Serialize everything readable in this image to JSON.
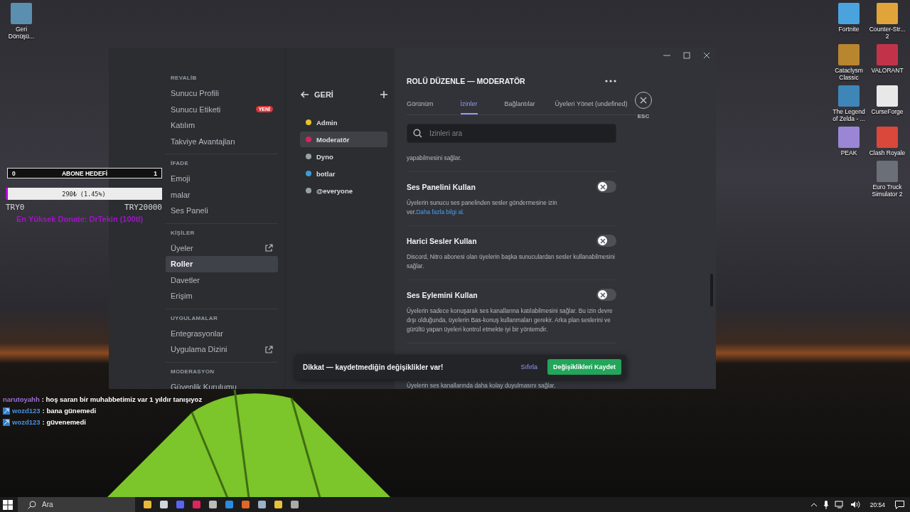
{
  "desktop_icons_left": [
    {
      "label": "Geri Dönüşü...",
      "color": "#5b8fb0"
    }
  ],
  "desktop_icons": [
    {
      "label": "Fortnite",
      "color": "#4aa3df"
    },
    {
      "label": "Counter-Str... 2",
      "color": "#e0a43a"
    },
    {
      "label": "Cataclysm Classic",
      "color": "#b8862f"
    },
    {
      "label": "VALORANT",
      "color": "#c2334a"
    },
    {
      "label": "The Legend of Zelda - ...",
      "color": "#3f86b8"
    },
    {
      "label": "CurseForge",
      "color": "#e8e8e8"
    },
    {
      "label": "PEAK",
      "color": "#9b86d6"
    },
    {
      "label": "Clash Royale",
      "color": "#d9483b"
    },
    {
      "label": "Euro Truck Simulator 2",
      "color": "#6a6f78"
    }
  ],
  "overlay": {
    "goal": {
      "start": "0",
      "title": "ABONE HEDEFİ",
      "end": "1"
    },
    "donation": {
      "reading": "290₺ (1.45%)",
      "level": 0.0145,
      "min": "TRY0",
      "max": "TRY20000",
      "top_donor": "En Yüksek Donate: DrTekin (100tl)"
    }
  },
  "window": {
    "sidebar": {
      "sections": [
        {
          "title": "REVALİB",
          "items": [
            {
              "label": "Sunucu Profili",
              "selected": false,
              "external": false
            },
            {
              "label": "Sunucu Etiketi",
              "selected": false,
              "external": false,
              "badge": "YENİ"
            },
            {
              "label": "Katılım",
              "selected": false,
              "external": false
            },
            {
              "label": "Takviye Avantajları",
              "selected": false,
              "external": false
            }
          ]
        },
        {
          "title": "İFADE",
          "items": [
            {
              "label": "Emoji",
              "selected": false,
              "external": false
            },
            {
              "label": "malar",
              "selected": false,
              "external": false
            },
            {
              "label": "Ses Paneli",
              "selected": false,
              "external": false
            }
          ]
        },
        {
          "title": "KİŞİLER",
          "items": [
            {
              "label": "Üyeler",
              "selected": false,
              "external": true
            },
            {
              "label": "Roller",
              "selected": true,
              "external": false
            },
            {
              "label": "Davetler",
              "selected": false,
              "external": false
            },
            {
              "label": "Erişim",
              "selected": false,
              "external": false
            }
          ]
        },
        {
          "title": "UYGULAMALAR",
          "items": [
            {
              "label": "Entegrasyonlar",
              "selected": false,
              "external": false
            },
            {
              "label": "Uygulama Dizini",
              "selected": false,
              "external": true
            }
          ]
        },
        {
          "title": "MODERASYON",
          "items": [
            {
              "label": "Güvenlik Kurulumu",
              "selected": false,
              "external": false
            }
          ]
        }
      ]
    },
    "roles": {
      "back": "GERİ",
      "items": [
        {
          "name": "Admin",
          "color": "#e6c229",
          "selected": false
        },
        {
          "name": "Moderatör",
          "color": "#d6245a",
          "selected": true
        },
        {
          "name": "Dyno",
          "color": "#99a0a6",
          "selected": false
        },
        {
          "name": "botlar",
          "color": "#3f9bd6",
          "selected": false
        },
        {
          "name": "@everyone",
          "color": "#99a0a6",
          "selected": false
        }
      ]
    },
    "editor": {
      "title": "ROLÜ DÜZENLE — MODERATÖR",
      "close_label": "ESC",
      "tabs": [
        {
          "label": "Görünüm",
          "selected": false
        },
        {
          "label": "İzinler",
          "selected": true
        },
        {
          "label": "Bağlantılar",
          "selected": false
        },
        {
          "label": "Üyeleri Yönet (undefined)",
          "selected": false
        }
      ],
      "search": {
        "placeholder": "İzinleri ara"
      },
      "permissions": [
        {
          "kind": "fragment",
          "description": "yapabilmesini sağlar."
        },
        {
          "kind": "permission",
          "title": "Ses Panelini Kullan",
          "on": false,
          "description": "Üyelerin sunucu ses panelinden sesler göndermesine izin ver.",
          "link": "Daha fazla bilgi al."
        },
        {
          "kind": "permission",
          "title": "Harici Sesler Kullan",
          "on": false,
          "description": "Discord, Nitro abonesi olan üyelerin başka sunuculardan sesler kullanabilmesini sağlar."
        },
        {
          "kind": "permission",
          "title": "Ses Eylemini Kullan",
          "on": false,
          "description": "Üyelerin sadece konuşarak ses kanallarına katılabilmesini sağlar. Bu izin devre dışı olduğunda, üyelerin Bas-konuş kullanmaları gerekir. Arka plan seslerini ve gürültü yapan üyeleri kontrol etmekte iyi bir yöntemdir."
        },
        {
          "kind": "fragment",
          "description": "Üyelerin ses kanallarında daha kolay duyulmasını sağlar."
        }
      ]
    },
    "notice": {
      "message": "Dikkat — kaydetmediğin değişiklikler var!",
      "reset": "Sıfırla",
      "save": "Değişiklikleri Kaydet"
    }
  },
  "chat": [
    {
      "user": "narutoyahh",
      "color": "#9b6fd6",
      "badge": false,
      "message": ": hoş saran bir muhabbetimiz var 1 yıldır tanışıyoz"
    },
    {
      "user": "wozd123",
      "color": "#4a8fe0",
      "badge": true,
      "message": ": bana günemedi"
    },
    {
      "user": "wozd123",
      "color": "#4a8fe0",
      "badge": true,
      "message": ": güvenemedi"
    }
  ],
  "taskbar": {
    "search_placeholder": "Ara",
    "clock": "20:54"
  }
}
